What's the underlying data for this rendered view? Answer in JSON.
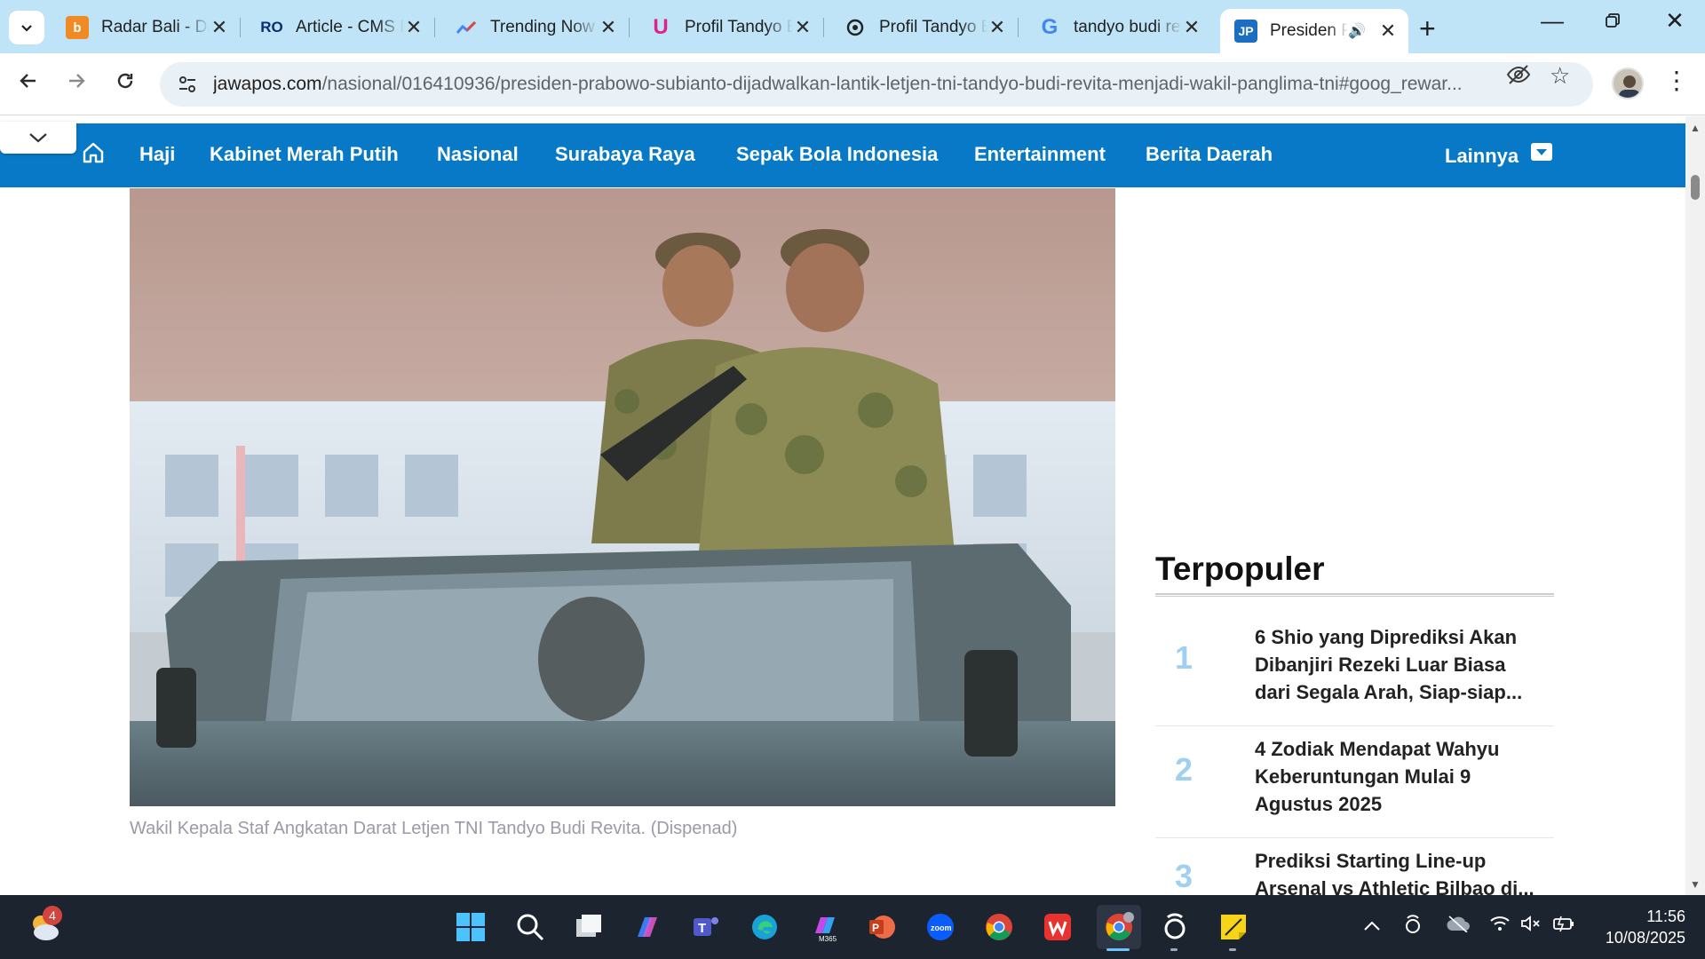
{
  "browser": {
    "tabs": [
      {
        "title": "Radar Bali - Daftar",
        "favicon": "radar-bali-favicon",
        "active": false
      },
      {
        "title": "Article - CMS Radar",
        "favicon": "cms-favicon",
        "active": false
      },
      {
        "title": "Trending Now - Google",
        "favicon": "trends-favicon",
        "active": false
      },
      {
        "title": "Profil Tandyo Budi",
        "favicon": "unair-favicon",
        "active": false
      },
      {
        "title": "Profil Tandyo Budi",
        "favicon": "chatgpt-favicon",
        "active": false
      },
      {
        "title": "tandyo budi revita",
        "favicon": "google-favicon",
        "active": false
      },
      {
        "title": "Presiden Prabowo",
        "favicon": "jawapos-favicon",
        "active": true
      }
    ],
    "url_host": "jawapos.com",
    "url_path": "/nasional/016410936/presiden-prabowo-subianto-dijadwalkan-lantik-letjen-tni-tandyo-budi-revita-menjadi-wakil-panglima-tni#goog_rewar..."
  },
  "site": {
    "nav_items": [
      "Haji",
      "Kabinet Merah Putih",
      "Nasional",
      "Surabaya Raya",
      "Sepak Bola Indonesia",
      "Entertainment",
      "Berita Daerah"
    ],
    "nav_more": "Lainnya"
  },
  "article": {
    "photo_caption": "Wakil Kepala Staf Angkatan Darat Letjen TNI Tandyo Budi Revita. (Dispenad)"
  },
  "sidebar": {
    "title": "Terpopuler",
    "items": [
      {
        "rank": "1",
        "text": "6 Shio yang Diprediksi Akan Dibanjiri Rezeki Luar Biasa dari Segala Arah, Siap-siap..."
      },
      {
        "rank": "2",
        "text": "4 Zodiak Mendapat Wahyu Keberuntungan Mulai 9 Agustus 2025"
      },
      {
        "rank": "3",
        "text": "Prediksi Starting Line-up Arsenal vs Athletic Bilbao di..."
      }
    ]
  },
  "taskbar": {
    "weather_badge": "4",
    "time": "11:56",
    "date": "10/08/2025"
  },
  "colors": {
    "tabstrip": "#bfe4f7",
    "nav_blue": "#0879c7",
    "rank_blue": "#9fd0f0",
    "taskbar": "#1c2430"
  }
}
